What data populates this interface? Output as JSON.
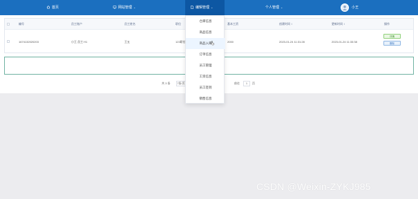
{
  "nav": {
    "items": [
      {
        "label": "首页",
        "icon": "home-icon"
      },
      {
        "label": "网站管理",
        "icon": "monitor-icon",
        "caret": "⌄"
      },
      {
        "label": "编辑管理",
        "icon": "doc-icon",
        "caret": "⌄"
      },
      {
        "label": "个人管理",
        "caret": "⌄"
      }
    ],
    "user": "小王"
  },
  "table": {
    "headers": [
      "编号",
      "员工账户",
      "员工姓名",
      "职位",
      "基本工资",
      "创建时间 ↕",
      "更新时间 ↕",
      "操作"
    ],
    "rows": [
      {
        "id": "1674132020203",
        "account": "小王 员工 H1",
        "name": "王五",
        "position": "123职位",
        "salary": "2000",
        "created": "2023-01-24 11:31:28",
        "updated": "2023-01-24 11:33:38"
      }
    ],
    "actions": {
      "edit": "详情",
      "delete": "删除"
    }
  },
  "pagination": {
    "total": "共 3 条",
    "page_size": "7条/页",
    "goto_label": "前往",
    "page": "1",
    "page_unit": "页"
  },
  "dropdown": {
    "items": [
      "仓库信息",
      "商品信息",
      "商品入库",
      "订单信息",
      "员工管理",
      "工资信息",
      "员工签到",
      "销售信息"
    ],
    "hover_index": 2
  },
  "watermark": "CSDN @Weixin-ZYKJ985",
  "colors": {
    "nav_bg": "#1b6fbf",
    "nav_active": "#0d57a3",
    "empty_border": "#6fb2a2",
    "page_bg": "#ececef"
  }
}
